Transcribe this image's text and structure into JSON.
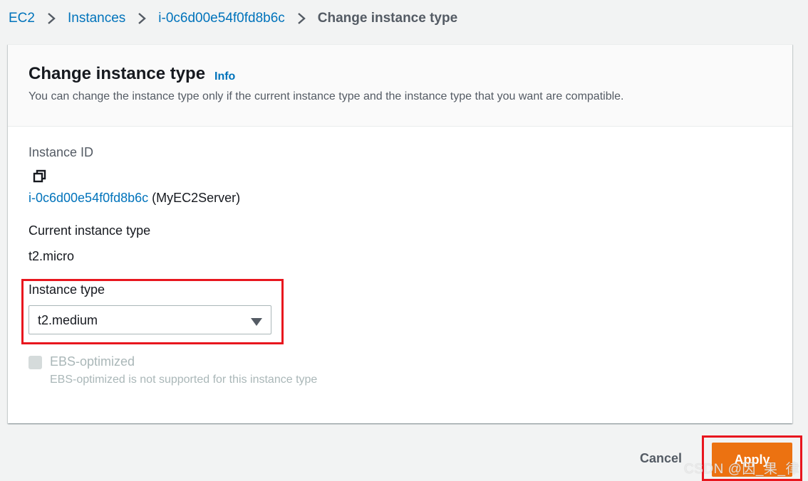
{
  "breadcrumb": {
    "items": [
      {
        "label": "EC2"
      },
      {
        "label": "Instances"
      },
      {
        "label": "i-0c6d00e54f0fd8b6c"
      }
    ],
    "current": "Change instance type"
  },
  "panel": {
    "title": "Change instance type",
    "info_link": "Info",
    "description": "You can change the instance type only if the current instance type and the instance type that you want are compatible."
  },
  "instance": {
    "id_label": "Instance ID",
    "id_value": "i-0c6d00e54f0fd8b6c",
    "name_suffix": "(MyEC2Server)",
    "current_type_label": "Current instance type",
    "current_type_value": "t2.micro"
  },
  "instance_type_select": {
    "label": "Instance type",
    "selected": "t2.medium"
  },
  "ebs": {
    "label": "EBS-optimized",
    "description": "EBS-optimized is not supported for this instance type",
    "checked": false,
    "disabled": true
  },
  "footer": {
    "cancel_label": "Cancel",
    "apply_label": "Apply"
  },
  "watermark": "CSDN @因_果_律",
  "colors": {
    "link": "#0073bb",
    "primary_button": "#ec7211",
    "highlight": "#e8161e"
  },
  "icons": {
    "separator": "chevron-right-icon",
    "copy": "copy-icon",
    "select_caret": "caret-down-icon"
  }
}
